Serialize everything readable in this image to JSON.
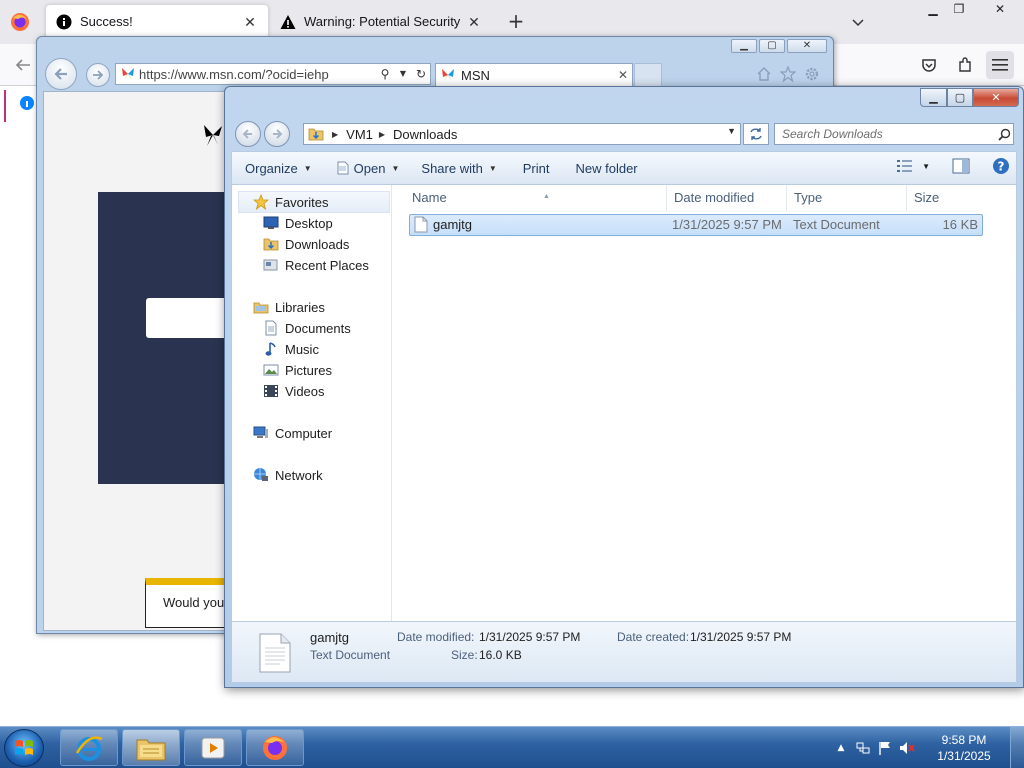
{
  "firefox": {
    "tabs": [
      {
        "title": "Success!"
      },
      {
        "title": "Warning: Potential Security Risk"
      }
    ],
    "new_tab": "+"
  },
  "ie": {
    "address": "https://www.msn.com/?ocid=iehp",
    "tab_title": "MSN",
    "consent_text": "Would you l"
  },
  "explorer": {
    "breadcrumb": [
      "VM1",
      "Downloads"
    ],
    "search_placeholder": "Search Downloads",
    "toolbar": {
      "organize": "Organize",
      "open": "Open",
      "share_with": "Share with",
      "print": "Print",
      "new_folder": "New folder"
    },
    "nav": {
      "favorites": "Favorites",
      "desktop": "Desktop",
      "downloads": "Downloads",
      "recent_places": "Recent Places",
      "libraries": "Libraries",
      "documents": "Documents",
      "music": "Music",
      "pictures": "Pictures",
      "videos": "Videos",
      "computer": "Computer",
      "network": "Network"
    },
    "columns": {
      "name": "Name",
      "date_modified": "Date modified",
      "type": "Type",
      "size": "Size"
    },
    "files": [
      {
        "name": "gamjtg",
        "date_modified": "1/31/2025 9:57 PM",
        "type": "Text Document",
        "size": "16 KB"
      }
    ],
    "details": {
      "name": "gamjtg",
      "type": "Text Document",
      "date_modified_label": "Date modified:",
      "date_modified": "1/31/2025 9:57 PM",
      "date_created_label": "Date created:",
      "date_created": "1/31/2025 9:57 PM",
      "size_label": "Size:",
      "size": "16.0 KB"
    }
  },
  "taskbar": {
    "time": "9:58 PM",
    "date": "1/31/2025"
  }
}
